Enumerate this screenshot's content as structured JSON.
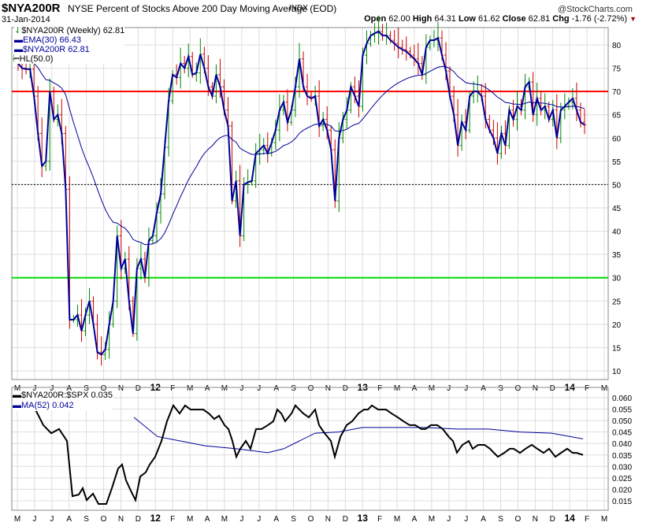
{
  "header": {
    "symbol": "$NYA200R",
    "title": "NYSE Percent of Stocks Above 200 Day Moving Average (EOD)",
    "exchange": "INDX",
    "date": "31-Jan-2014",
    "brand": "@StockCharts.com",
    "open_label": "Open",
    "open": "62.00",
    "high_label": "High",
    "high": "64.31",
    "low_label": "Low",
    "low": "61.62",
    "close_label": "Close",
    "close": "62.81",
    "chg_label": "Chg",
    "chg": "-1.76 (-2.72%)"
  },
  "colors": {
    "upper": "#ff0000",
    "lower": "#00dd00",
    "line": "#000099",
    "up": "#008800",
    "down": "#cc0000"
  },
  "chart_data": [
    {
      "type": "line",
      "title": "$NYA200R NYSE Percent of Stocks Above 200 Day Moving Average (EOD)",
      "legend": [
        "$NYA200R (Weekly) 62.81",
        "EMA(30) 66.43",
        "$NYA200R 62.81",
        "HL(50.0)"
      ],
      "ylim": [
        8,
        84
      ],
      "yticks": [
        10,
        15,
        20,
        25,
        30,
        35,
        40,
        45,
        50,
        55,
        60,
        65,
        70,
        75,
        80
      ],
      "hlines": [
        70,
        50,
        30
      ],
      "ema_period": 30,
      "closes": [
        77,
        76,
        75,
        74.8,
        74.8,
        69,
        61,
        54,
        55,
        70,
        64,
        65,
        61,
        49,
        21,
        21,
        22,
        18.6,
        22,
        25,
        20,
        14,
        13.5,
        14.6,
        20,
        25,
        39,
        32,
        34,
        25,
        18,
        32,
        34,
        30,
        38,
        39,
        44,
        48,
        58,
        68,
        73.6,
        73,
        76,
        75,
        77.5,
        73.6,
        74,
        78,
        75,
        71,
        69,
        73.6,
        71,
        66,
        62.6,
        46.5,
        50.8,
        39,
        50,
        50.5,
        50.8,
        56.7,
        57.5,
        58.4,
        56.7,
        59,
        61.7,
        66,
        67.7,
        63.4,
        66,
        71,
        77,
        71,
        69,
        68.5,
        69,
        62.6,
        64,
        61.7,
        57.5,
        46.5,
        60,
        64,
        66,
        71,
        69,
        66.8,
        77.8,
        80.3,
        82,
        82.5,
        82.9,
        82,
        82,
        81,
        80.3,
        79.5,
        79,
        78.6,
        77.8,
        77,
        76,
        73.6,
        79.5,
        81,
        81,
        81.5,
        77.8,
        74.4,
        69,
        65,
        58.4,
        63.4,
        61.7,
        69,
        70,
        70,
        69,
        64,
        61.7,
        60,
        56.7,
        61,
        58.4,
        66,
        64,
        66.8,
        66,
        71,
        72,
        65,
        68.5,
        66,
        66.8,
        64,
        66,
        60,
        66,
        66.8,
        67.7,
        68.5,
        66,
        63.4,
        62.81
      ],
      "xticks": [
        "M",
        "J",
        "J",
        "A",
        "S",
        "O",
        "N",
        "D",
        "12",
        "F",
        "M",
        "A",
        "M",
        "J",
        "J",
        "A",
        "S",
        "O",
        "N",
        "D",
        "13",
        "F",
        "M",
        "A",
        "M",
        "J",
        "J",
        "A",
        "S",
        "O",
        "N",
        "D",
        "14",
        "F",
        "M"
      ]
    },
    {
      "type": "line",
      "legend": [
        "$NYA200R:$SPX 0.035",
        "MA(52) 0.042"
      ],
      "ylim": [
        0.012,
        0.062
      ],
      "yticks": [
        "0.015",
        "0.020",
        "0.025",
        "0.030",
        "0.035",
        "0.040",
        "0.045",
        "0.050",
        "0.055",
        "0.060"
      ],
      "weeks_total": 146,
      "ratio": [
        [
          0,
          0.06
        ],
        [
          2.4,
          0.0583
        ],
        [
          5.4,
          0.0548
        ],
        [
          7.4,
          0.048
        ],
        [
          9.4,
          0.0445
        ],
        [
          11.4,
          0.0463
        ],
        [
          13.4,
          0.0411
        ],
        [
          14.8,
          0.017
        ],
        [
          16.4,
          0.0177
        ],
        [
          17.4,
          0.0205
        ],
        [
          18.4,
          0.0153
        ],
        [
          20,
          0.0181
        ],
        [
          21.4,
          0.0136
        ],
        [
          23.4,
          0.0136
        ],
        [
          24.8,
          0.0205
        ],
        [
          26.4,
          0.0291
        ],
        [
          27.4,
          0.0308
        ],
        [
          28.4,
          0.0239
        ],
        [
          29.8,
          0.0187
        ],
        [
          30.8,
          0.0153
        ],
        [
          32,
          0.0256
        ],
        [
          33.4,
          0.0274
        ],
        [
          34.4,
          0.0308
        ],
        [
          35.8,
          0.0342
        ],
        [
          37.4,
          0.0411
        ],
        [
          38.8,
          0.0497
        ],
        [
          40.4,
          0.0566
        ],
        [
          42,
          0.0531
        ],
        [
          43.4,
          0.0566
        ],
        [
          44.8,
          0.0548
        ],
        [
          46.4,
          0.0548
        ],
        [
          48,
          0.0548
        ],
        [
          49.4,
          0.0531
        ],
        [
          50.8,
          0.0507
        ],
        [
          52,
          0.0521
        ],
        [
          53.4,
          0.048
        ],
        [
          54.4,
          0.0463
        ],
        [
          55.4,
          0.0411
        ],
        [
          56.4,
          0.0342
        ],
        [
          57.4,
          0.0377
        ],
        [
          58.8,
          0.0411
        ],
        [
          60,
          0.0377
        ],
        [
          61.4,
          0.0463
        ],
        [
          62.8,
          0.0463
        ],
        [
          64.4,
          0.048
        ],
        [
          65.8,
          0.0497
        ],
        [
          66.8,
          0.0548
        ],
        [
          67.8,
          0.0531
        ],
        [
          68.8,
          0.0497
        ],
        [
          70.4,
          0.0531
        ],
        [
          71.4,
          0.0566
        ],
        [
          72.4,
          0.0548
        ],
        [
          73.4,
          0.0531
        ],
        [
          74.8,
          0.0514
        ],
        [
          76.4,
          0.0548
        ],
        [
          77.4,
          0.048
        ],
        [
          78.8,
          0.0445
        ],
        [
          80.4,
          0.0411
        ],
        [
          81.4,
          0.0342
        ],
        [
          82.8,
          0.0428
        ],
        [
          84.4,
          0.048
        ],
        [
          85.8,
          0.0497
        ],
        [
          87.4,
          0.0531
        ],
        [
          88.8,
          0.0548
        ],
        [
          89.8,
          0.0548
        ],
        [
          90.8,
          0.0566
        ],
        [
          92.4,
          0.0548
        ],
        [
          94.4,
          0.0548
        ],
        [
          95.8,
          0.0531
        ],
        [
          97.4,
          0.0514
        ],
        [
          98.8,
          0.0497
        ],
        [
          100.4,
          0.048
        ],
        [
          101.8,
          0.048
        ],
        [
          103.4,
          0.0463
        ],
        [
          104.4,
          0.0463
        ],
        [
          105.8,
          0.048
        ],
        [
          107.4,
          0.048
        ],
        [
          108.8,
          0.0463
        ],
        [
          110.4,
          0.0428
        ],
        [
          111.4,
          0.0411
        ],
        [
          112.4,
          0.036
        ],
        [
          113.8,
          0.0394
        ],
        [
          115.4,
          0.0411
        ],
        [
          116.4,
          0.0377
        ],
        [
          117.8,
          0.0394
        ],
        [
          119.4,
          0.0394
        ],
        [
          120.8,
          0.0377
        ],
        [
          121.8,
          0.0359
        ],
        [
          122.8,
          0.0342
        ],
        [
          124.4,
          0.0359
        ],
        [
          125.8,
          0.0377
        ],
        [
          126.8,
          0.0377
        ],
        [
          128.4,
          0.0359
        ],
        [
          129.8,
          0.0377
        ],
        [
          131.4,
          0.0394
        ],
        [
          132.8,
          0.0377
        ],
        [
          134.4,
          0.0359
        ],
        [
          135.8,
          0.0377
        ],
        [
          137.4,
          0.0342
        ],
        [
          138.8,
          0.0359
        ],
        [
          140.4,
          0.0377
        ],
        [
          141.8,
          0.0359
        ],
        [
          142.8,
          0.0359
        ],
        [
          144.4,
          0.035
        ]
      ],
      "ma": [
        [
          30.4,
          0.0514
        ],
        [
          36.4,
          0.043
        ],
        [
          42.4,
          0.041
        ],
        [
          48.4,
          0.039
        ],
        [
          56.4,
          0.0377
        ],
        [
          64.4,
          0.036
        ],
        [
          68.4,
          0.0377
        ],
        [
          72.4,
          0.0411
        ],
        [
          76.4,
          0.0445
        ],
        [
          82.4,
          0.045
        ],
        [
          88.4,
          0.047
        ],
        [
          96.4,
          0.047
        ],
        [
          104.4,
          0.047
        ],
        [
          112.4,
          0.0463
        ],
        [
          120.4,
          0.0463
        ],
        [
          128.4,
          0.045
        ],
        [
          136.4,
          0.0445
        ],
        [
          144.4,
          0.042
        ]
      ]
    }
  ]
}
